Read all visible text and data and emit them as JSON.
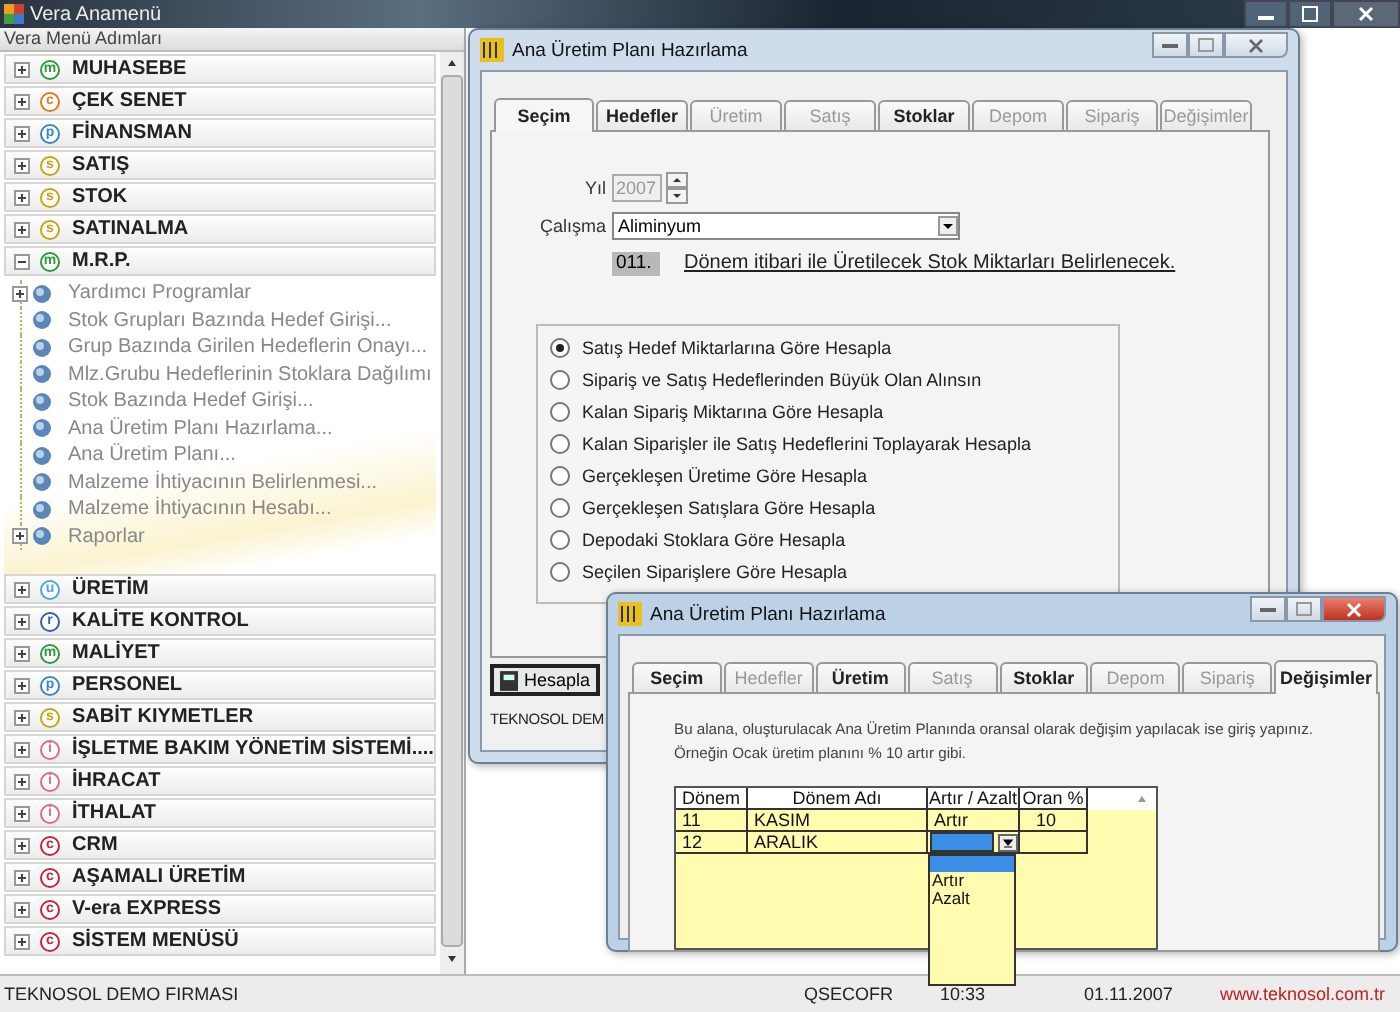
{
  "app_window": {
    "title": "Vera Anamenü"
  },
  "menu_panel": {
    "title": "Vera Menü Adımları",
    "modules": [
      {
        "label": "MUHASEBE",
        "badge": "m",
        "color": "#2e9b3e",
        "expanded": false
      },
      {
        "label": "ÇEK SENET",
        "badge": "c",
        "color": "#e07a1f",
        "expanded": false
      },
      {
        "label": "FİNANSMAN",
        "badge": "p",
        "color": "#3a86c8",
        "expanded": false
      },
      {
        "label": "SATIŞ",
        "badge": "s",
        "color": "#c9a512",
        "expanded": false
      },
      {
        "label": "STOK",
        "badge": "s",
        "color": "#c9a512",
        "expanded": false
      },
      {
        "label": "SATINALMA",
        "badge": "s",
        "color": "#c9a512",
        "expanded": false
      },
      {
        "label": "M.R.P.",
        "badge": "m",
        "color": "#2e9b3e",
        "expanded": true,
        "children": [
          {
            "label": "Yardımcı Programlar",
            "kind": "folder"
          },
          {
            "label": "Stok Grupları Bazında Hedef Girişi...",
            "kind": "leaf"
          },
          {
            "label": "Grup Bazında Girilen Hedeflerin Onayı...",
            "kind": "leaf"
          },
          {
            "label": "Mlz.Grubu Hedeflerinin Stoklara Dağılımı",
            "kind": "leaf"
          },
          {
            "label": "Stok Bazında Hedef Girişi...",
            "kind": "leaf"
          },
          {
            "label": "Ana Üretim Planı Hazırlama...",
            "kind": "leaf"
          },
          {
            "label": "Ana Üretim Planı...",
            "kind": "leaf"
          },
          {
            "label": "Malzeme İhtiyacının Belirlenmesi...",
            "kind": "leaf"
          },
          {
            "label": "Malzeme İhtiyacının Hesabı...",
            "kind": "leaf"
          },
          {
            "label": "Raporlar",
            "kind": "folder"
          }
        ]
      },
      {
        "label": "ÜRETİM",
        "badge": "u",
        "color": "#4aa8d8",
        "expanded": false
      },
      {
        "label": "KALİTE KONTROL",
        "badge": "r",
        "color": "#3560b0",
        "expanded": false
      },
      {
        "label": "MALİYET",
        "badge": "m",
        "color": "#2e9b3e",
        "expanded": false
      },
      {
        "label": "PERSONEL",
        "badge": "p",
        "color": "#3a86c8",
        "expanded": false
      },
      {
        "label": "SABİT KIYMETLER",
        "badge": "s",
        "color": "#c9a512",
        "expanded": false
      },
      {
        "label": "İŞLETME BAKIM YÖNETİM SİSTEMİ....",
        "badge": "i",
        "color": "#e06a80",
        "expanded": false
      },
      {
        "label": "İHRACAT",
        "badge": "i",
        "color": "#e06a80",
        "expanded": false
      },
      {
        "label": "İTHALAT",
        "badge": "i",
        "color": "#e06a80",
        "expanded": false
      },
      {
        "label": "CRM",
        "badge": "c",
        "color": "#c0283a",
        "expanded": false
      },
      {
        "label": "AŞAMALI ÜRETİM",
        "badge": "c",
        "color": "#c0283a",
        "expanded": false
      },
      {
        "label": "V-era EXPRESS",
        "badge": "c",
        "color": "#c0283a",
        "expanded": false
      },
      {
        "label": "SİSTEM MENÜSÜ",
        "badge": "c",
        "color": "#c0283a",
        "expanded": false
      }
    ]
  },
  "plan_window": {
    "title": "Ana Üretim Planı Hazırlama",
    "tabs": [
      {
        "label": "Seçim",
        "selected": true,
        "disabled": false
      },
      {
        "label": "Hedefler",
        "selected": false,
        "disabled": false
      },
      {
        "label": "Üretim",
        "selected": false,
        "disabled": true
      },
      {
        "label": "Satış",
        "selected": false,
        "disabled": true
      },
      {
        "label": "Stoklar",
        "selected": false,
        "disabled": false
      },
      {
        "label": "Depom",
        "selected": false,
        "disabled": true
      },
      {
        "label": "Sipariş",
        "selected": false,
        "disabled": true
      },
      {
        "label": "Değişimler",
        "selected": false,
        "disabled": true
      }
    ],
    "year_label": "Yıl",
    "year": "2007",
    "work_label": "Çalışma",
    "work": "Aliminyum",
    "period": "011.",
    "period_text": "Dönem itibari ile Üretilecek Stok Miktarları Belirlenecek.",
    "options": [
      {
        "label": "Satış Hedef Miktarlarına Göre Hesapla",
        "selected": true
      },
      {
        "label": "Sipariş ve Satış Hedeflerinden Büyük Olan Alınsın",
        "selected": false
      },
      {
        "label": "Kalan Sipariş Miktarına Göre Hesapla",
        "selected": false
      },
      {
        "label": "Kalan Siparişler ile Satış Hedeflerini Toplayarak Hesapla",
        "selected": false
      },
      {
        "label": "Gerçekleşen Üretime Göre Hesapla",
        "selected": false
      },
      {
        "label": "Gerçekleşen Satışlara Göre Hesapla",
        "selected": false
      },
      {
        "label": "Depodaki Stoklara Göre Hesapla",
        "selected": false
      },
      {
        "label": "Seçilen Siparişlere Göre Hesapla",
        "selected": false
      }
    ],
    "button": "Hesapla",
    "footer": "TEKNOSOL DEM"
  },
  "changes_window": {
    "title": "Ana Üretim Planı Hazırlama",
    "tabs": [
      {
        "label": "Seçim",
        "selected": false,
        "disabled": false
      },
      {
        "label": "Hedefler",
        "selected": false,
        "disabled": true
      },
      {
        "label": "Üretim",
        "selected": false,
        "disabled": false
      },
      {
        "label": "Satış",
        "selected": false,
        "disabled": true
      },
      {
        "label": "Stoklar",
        "selected": false,
        "disabled": false
      },
      {
        "label": "Depom",
        "selected": false,
        "disabled": true
      },
      {
        "label": "Sipariş",
        "selected": false,
        "disabled": true
      },
      {
        "label": "Değişimler",
        "selected": true,
        "disabled": false
      }
    ],
    "info": [
      "Bu alana, oluşturulacak Ana Üretim Planında oransal olarak değişim yapılacak ise giriş yapınız.",
      "Örneğin Ocak üretim planını % 10 artır gibi."
    ],
    "grid": {
      "columns": [
        "Dönem",
        "Dönem Adı",
        "Artır / Azalt",
        "Oran %"
      ],
      "rows": [
        {
          "period": "11",
          "name": "KASIM",
          "change": "Artır",
          "rate": "10",
          "editing": false
        },
        {
          "period": "12",
          "name": "ARALIK",
          "editing": true
        }
      ]
    },
    "dropdown_options": [
      "Artır",
      "Azalt"
    ]
  },
  "status_bar": {
    "company": "TEKNOSOL DEMO FIRMASI",
    "user": "QSECOFR",
    "time": "10:33",
    "date": "01.11.2007",
    "website": "www.teknosol.com.tr"
  }
}
